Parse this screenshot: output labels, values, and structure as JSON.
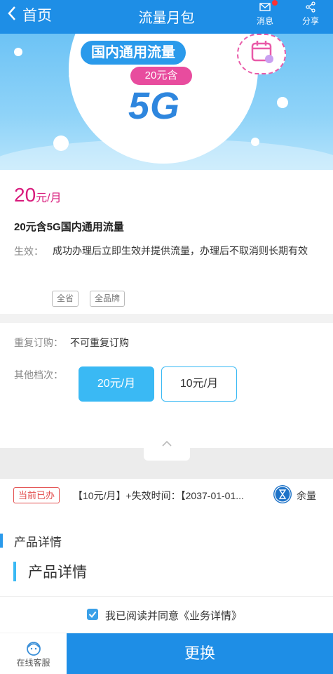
{
  "header": {
    "back_label": "首页",
    "title": "流量月包",
    "messages_label": "消息",
    "share_label": "分享",
    "icons": {
      "back": "chevron-left-icon",
      "messages": "mail-icon",
      "share": "share-icon"
    }
  },
  "banner": {
    "title": "国内通用流量",
    "badge": "20元含",
    "highlight": "5G",
    "icon": "calendar-icon"
  },
  "product": {
    "price": "20",
    "price_unit": "元/月",
    "name": "20元含5G国内通用流量",
    "effect_label": "生效：",
    "effect_text": "成功办理后立即生效并提供流量，办理后不取消则长期有效",
    "tags": [
      "全省",
      "全品牌"
    ]
  },
  "options": {
    "repeat_label": "重复订购：",
    "repeat_value": "不可重复订购",
    "tiers_label": "其他档次：",
    "tiers": [
      {
        "label": "20元/月",
        "selected": true
      },
      {
        "label": "10元/月",
        "selected": false
      }
    ]
  },
  "current": {
    "badge": "当前已办",
    "text": "【10元/月】+失效时间：【2037-01-01...",
    "remain_label": "余量",
    "remain_icon": "hourglass-icon"
  },
  "details": {
    "heading_small": "产品详情",
    "heading_large": "产品详情",
    "agree_text": "我已阅读并同意《业务详情》",
    "agree_checked": true
  },
  "footer": {
    "service_label": "在线客服",
    "service_icon": "customer-service-icon",
    "action_label": "更换"
  },
  "colors": {
    "header_blue": "#1e8ee6",
    "price_pink": "#d81b7c",
    "selected_blue": "#3ab9f4",
    "badge_red": "#e35050"
  }
}
